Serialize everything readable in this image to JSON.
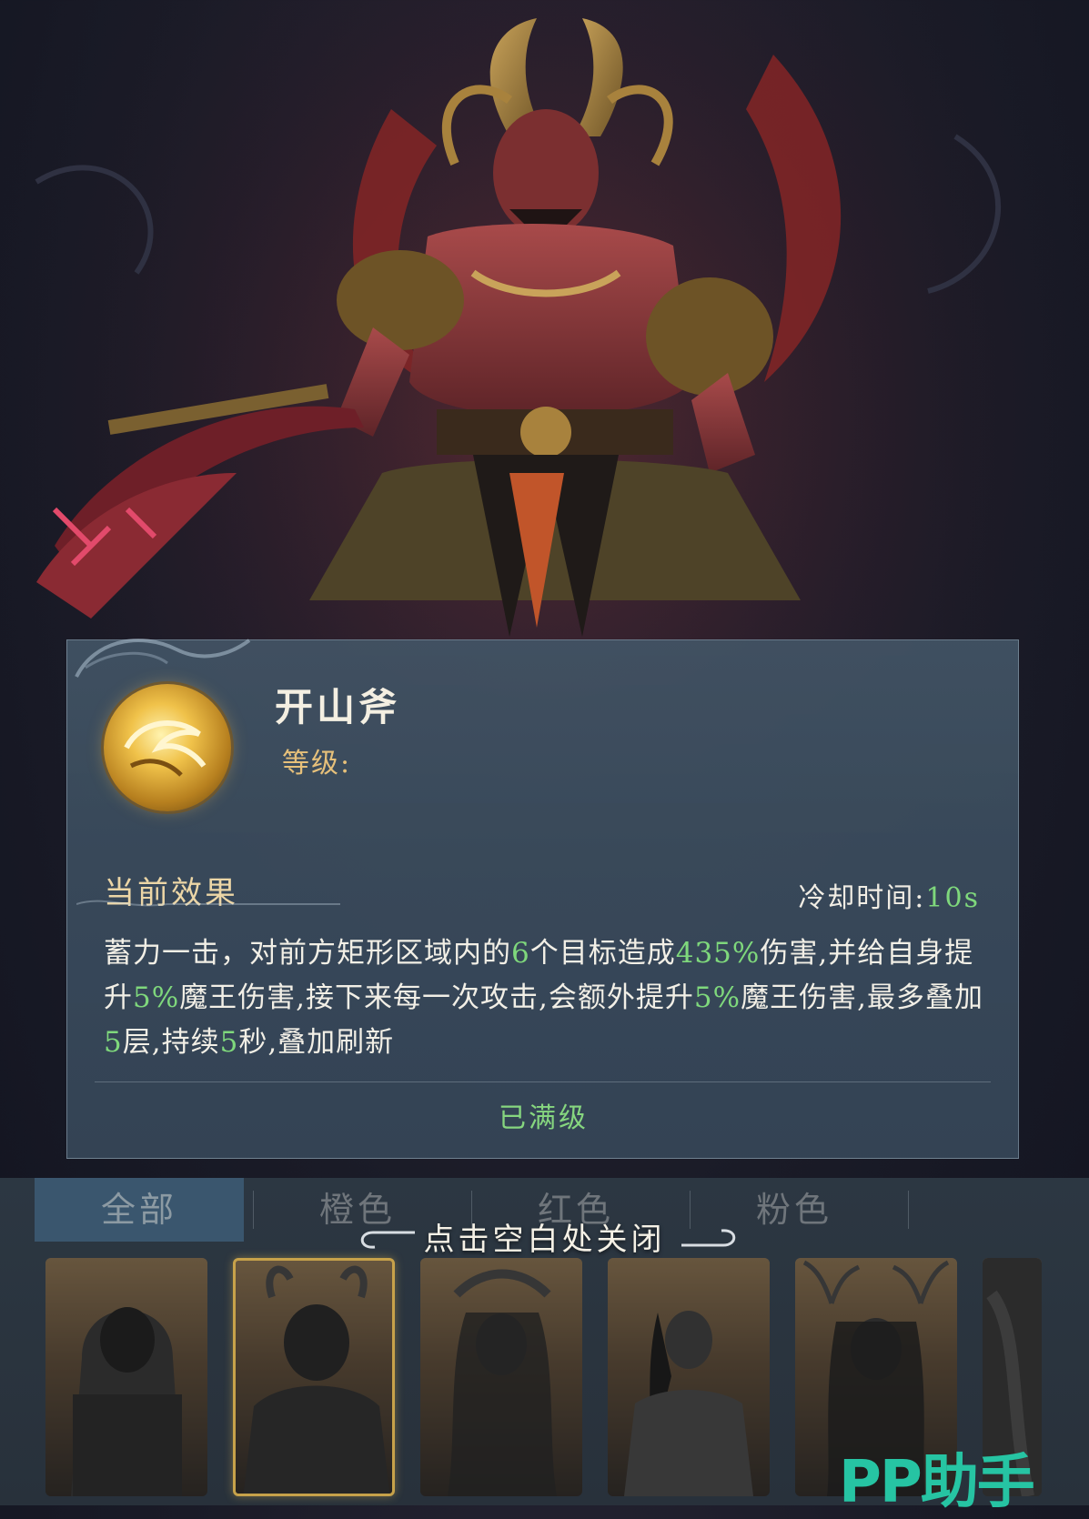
{
  "skill": {
    "name": "开山斧",
    "level_label": "等级:",
    "icon": "golden-swirl-skill-icon"
  },
  "effect": {
    "title": "当前效果",
    "cooldown_label": "冷却时间:",
    "cooldown_value": "10s",
    "description_segments": [
      {
        "text": "蓄力一击，对前方矩形区域内的",
        "highlight": false
      },
      {
        "text": "6",
        "highlight": true
      },
      {
        "text": "个目标造成",
        "highlight": false
      },
      {
        "text": "435%",
        "highlight": true
      },
      {
        "text": "伤害,并给自身提升",
        "highlight": false
      },
      {
        "text": "5%",
        "highlight": true
      },
      {
        "text": "魔王伤害,接下来每一次攻击,会额外提升",
        "highlight": false
      },
      {
        "text": "5%",
        "highlight": true
      },
      {
        "text": "魔王伤害,最多叠加",
        "highlight": false
      },
      {
        "text": "5",
        "highlight": true
      },
      {
        "text": "层,持续",
        "highlight": false
      },
      {
        "text": "5",
        "highlight": true
      },
      {
        "text": "秒,叠加刷新",
        "highlight": false
      }
    ],
    "status": "已满级"
  },
  "tabs": [
    {
      "label": "全部",
      "active": true
    },
    {
      "label": "橙色",
      "active": false
    },
    {
      "label": "红色",
      "active": false
    },
    {
      "label": "粉色",
      "active": false
    }
  ],
  "close_hint": "点击空白处关闭",
  "cards": [
    {
      "name": "hooded-warrior-portrait",
      "selected": false
    },
    {
      "name": "horned-demon-king-portrait",
      "selected": true
    },
    {
      "name": "crowned-goddess-portrait",
      "selected": false
    },
    {
      "name": "long-haired-swordsman-portrait",
      "selected": false
    },
    {
      "name": "antlered-sorceress-portrait",
      "selected": false
    },
    {
      "name": "partial-portrait",
      "selected": false
    }
  ],
  "watermark": "PP助手",
  "colors": {
    "highlight_green": "#7fd87c",
    "gold_label": "#e6c07a",
    "panel_bg": "#3e5063",
    "watermark": "#26c4a3"
  }
}
